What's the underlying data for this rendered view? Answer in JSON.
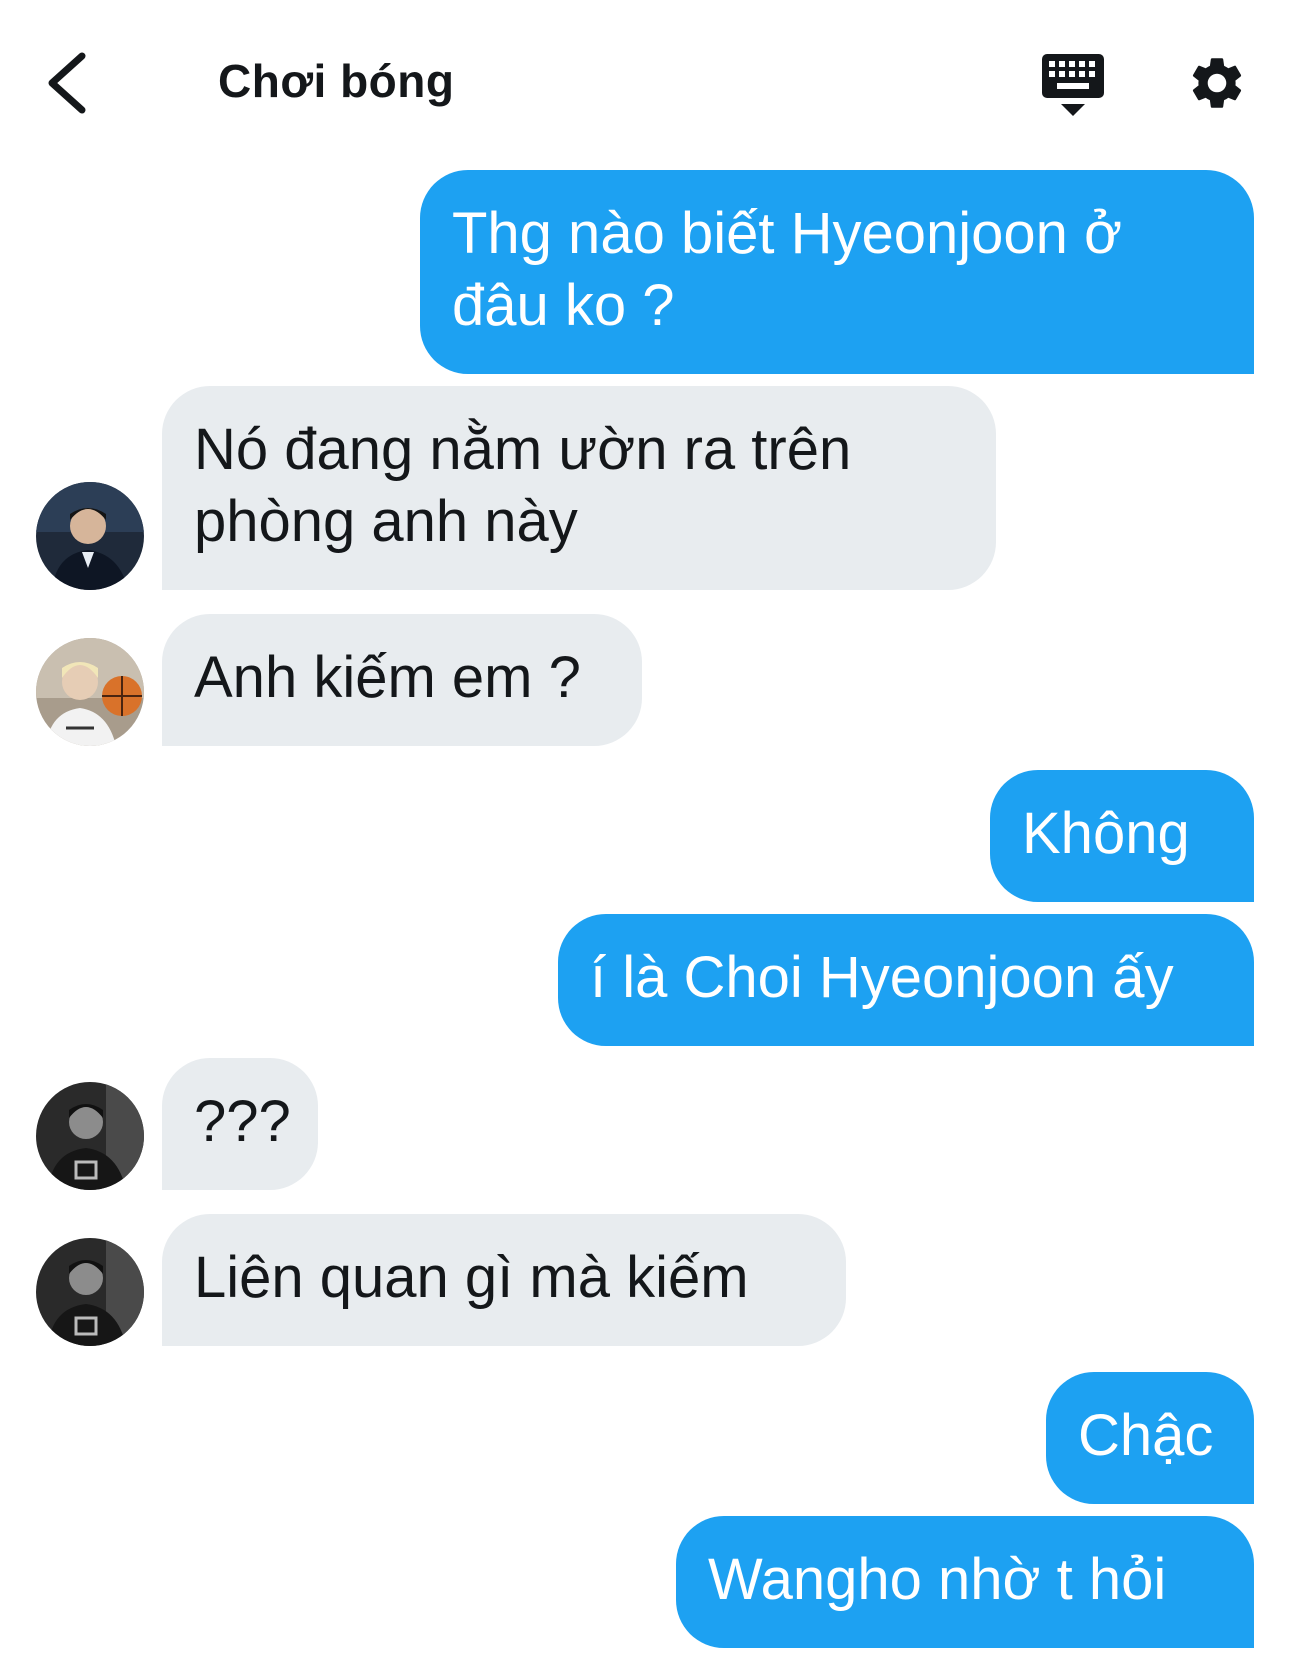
{
  "header": {
    "title": "Chơi bóng",
    "back_icon": "chevron-left-icon",
    "keyboard_icon": "keyboard-hide-icon",
    "settings_icon": "gear-icon"
  },
  "messages": [
    {
      "side": "out",
      "text_lines": [
        "Thg nào biết Hyeonjoon ở",
        "đâu ko ?"
      ]
    },
    {
      "side": "in",
      "text_lines": [
        "Nó đang nằm ườn ra trên",
        "phòng anh này"
      ]
    },
    {
      "side": "in",
      "text_lines": [
        "Anh kiếm em ?"
      ]
    },
    {
      "side": "out",
      "text_lines": [
        "Không"
      ]
    },
    {
      "side": "out",
      "text_lines": [
        "í là Choi Hyeonjoon ấy"
      ]
    },
    {
      "side": "in",
      "text_lines": [
        "???"
      ]
    },
    {
      "side": "in",
      "text_lines": [
        "Liên quan gì mà kiếm"
      ]
    },
    {
      "side": "out",
      "text_lines": [
        "Chậc"
      ]
    },
    {
      "side": "out",
      "text_lines": [
        "Wangho nhờ t hỏi"
      ]
    }
  ],
  "colors": {
    "outgoing_bubble": "#1da1f2",
    "incoming_bubble": "#e8ecef",
    "text_dark": "#14171a"
  }
}
